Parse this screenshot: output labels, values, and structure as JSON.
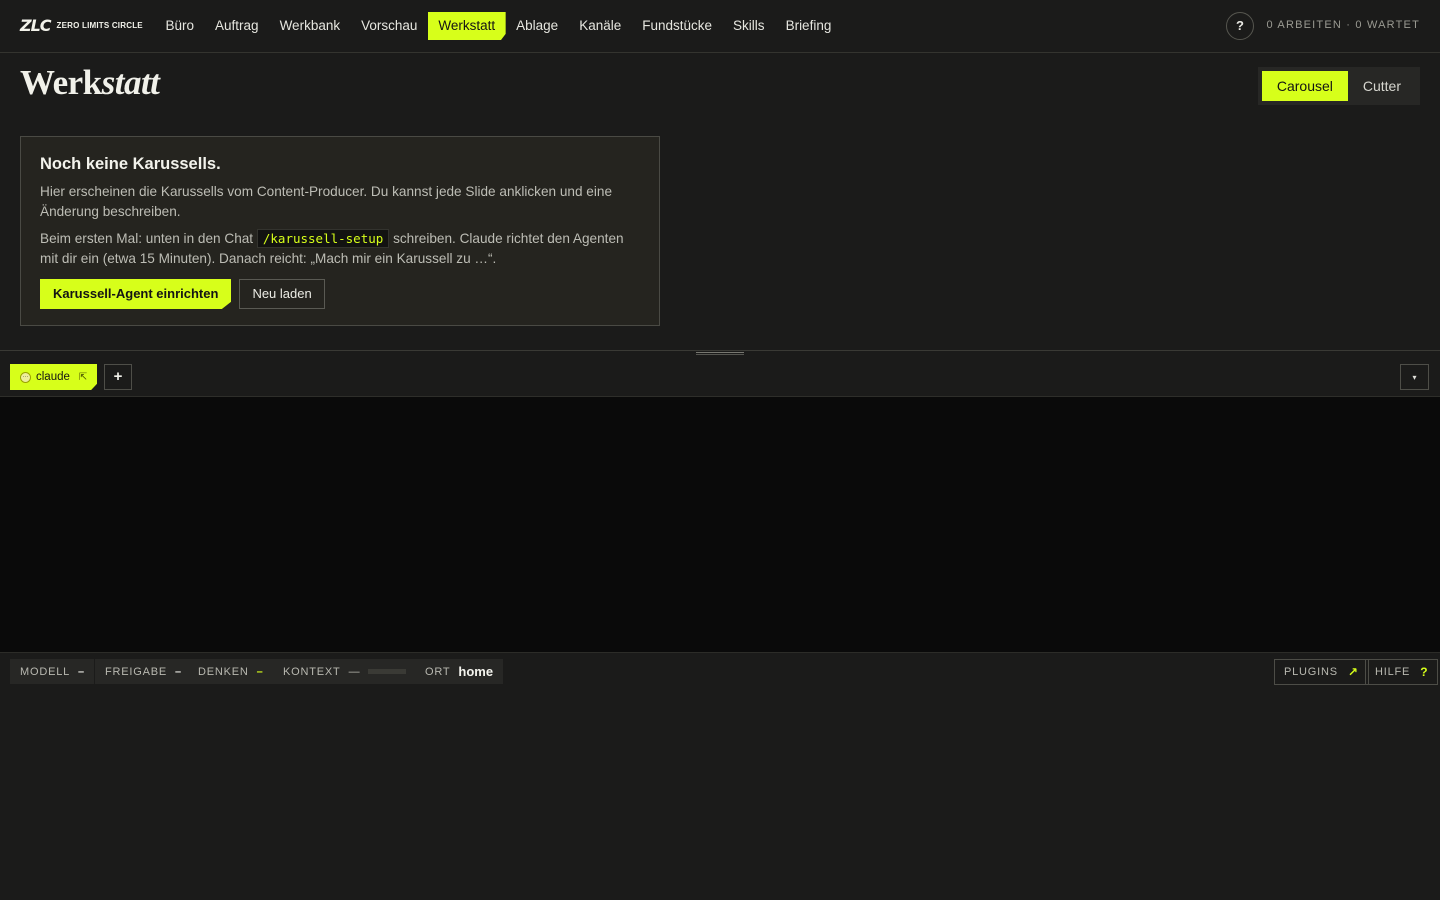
{
  "brand": {
    "mark": "ZLC",
    "name": "Zero Limits Circle"
  },
  "nav": [
    {
      "label": "Büro"
    },
    {
      "label": "Auftrag"
    },
    {
      "label": "Werkbank"
    },
    {
      "label": "Vorschau"
    },
    {
      "label": "Werkstatt",
      "active": true
    },
    {
      "label": "Ablage"
    },
    {
      "label": "Kanäle"
    },
    {
      "label": "Fundstücke"
    },
    {
      "label": "Skills"
    },
    {
      "label": "Briefing"
    }
  ],
  "header": {
    "help_label": "?",
    "job_status": "0 Arbeiten · 0 wartet"
  },
  "page": {
    "title_plain": "Werk",
    "title_italic": "statt",
    "segments": [
      {
        "label": "Carousel",
        "active": true
      },
      {
        "label": "Cutter",
        "active": false
      }
    ]
  },
  "empty_state": {
    "heading": "Noch keine Karussells.",
    "description": "Hier erscheinen die Karussells vom Content-Producer. Du kannst jede Slide anklicken und eine Änderung beschreiben.",
    "instructions_before": "Beim ersten Mal: unten in den Chat ",
    "command": "/karussell-setup",
    "instructions_after": " schreiben. Claude richtet den Agenten mit dir ein (etwa 15 Minuten). Danach reicht: „Mach mir ein Karussell zu …“.",
    "primary_button": "Karussell-Agent einrichten",
    "secondary_button": "Neu laden"
  },
  "terminal": {
    "tab_label": "claude",
    "add_label": "+",
    "collapse_label": "▾"
  },
  "status": {
    "model_label": "Modell",
    "model_value": "–",
    "freigabe_label": "Freigabe",
    "freigabe_value": "–",
    "denken_label": "Denken",
    "denken_value": "–",
    "kontext_label": "Kontext",
    "kontext_value": "—",
    "ort_label": "Ort",
    "ort_value": "home",
    "plugins_label": "Plugins",
    "plugins_icon": "↗",
    "hilfe_label": "Hilfe",
    "hilfe_icon": "?"
  }
}
